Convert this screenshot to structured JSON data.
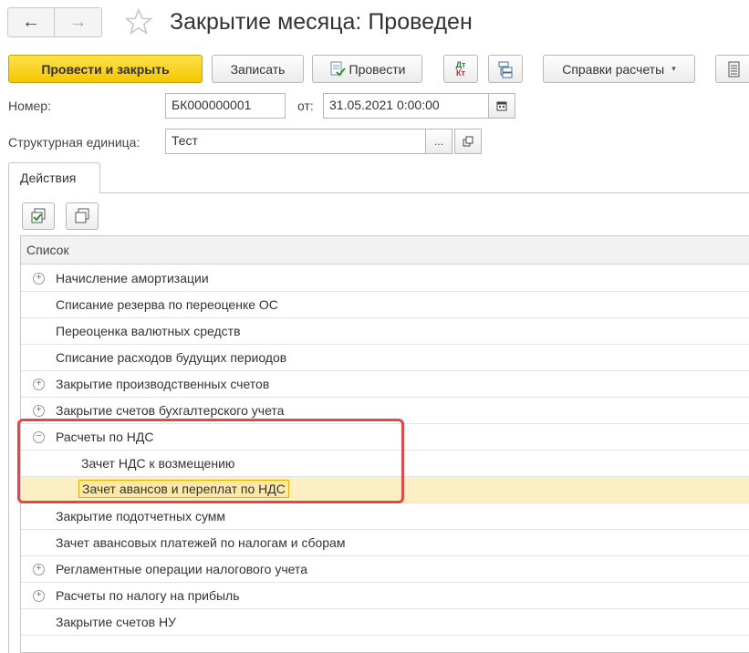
{
  "header": {
    "back_icon": "arrow-left-icon",
    "forward_icon": "arrow-right-icon",
    "favorite_icon": "star-icon",
    "title": "Закрытие месяца: Проведен"
  },
  "toolbar": {
    "post_and_close": "Провести и закрыть",
    "save": "Записать",
    "post": "Провести",
    "dt_kt_top": "Дт",
    "dt_kt_bottom": "Кт",
    "reports": "Справки расчеты",
    "reports_chevron": "▾"
  },
  "form": {
    "number_label": "Номер:",
    "number_value": "БК000000001",
    "date_label": "от:",
    "date_value": "31.05.2021  0:00:00",
    "unit_label": "Структурная единица:",
    "unit_value": "Тест",
    "unit_select": "..."
  },
  "tabs": [
    {
      "label": "Действия"
    }
  ],
  "table": {
    "header": "Список",
    "rows": [
      {
        "label": "Начисление амортизации",
        "expander": "+"
      },
      {
        "label": "Списание резерва по переоценке ОС",
        "expander": ""
      },
      {
        "label": "Переоценка валютных средств",
        "expander": ""
      },
      {
        "label": "Списание расходов будущих периодов",
        "expander": ""
      },
      {
        "label": "Закрытие производственных счетов",
        "expander": "+"
      },
      {
        "label": "Закрытие счетов бухгалтерского учета",
        "expander": "+"
      },
      {
        "label": "Расчеты по НДС",
        "expander": "−"
      },
      {
        "label": "Зачет НДС к возмещению",
        "expander": ""
      },
      {
        "label": "Зачет авансов и переплат по НДС",
        "expander": ""
      },
      {
        "label": "Закрытие подотчетных сумм",
        "expander": ""
      },
      {
        "label": "Зачет авансовых платежей по налогам и сборам",
        "expander": ""
      },
      {
        "label": "Регламентные операции налогового учета",
        "expander": "+"
      },
      {
        "label": "Расчеты по налогу на прибыль",
        "expander": "+"
      },
      {
        "label": "Закрытие счетов НУ",
        "expander": ""
      }
    ]
  },
  "colors": {
    "primary_button": "#f5c600",
    "selection": "#fbefc3",
    "highlight_border": "#e54646"
  }
}
